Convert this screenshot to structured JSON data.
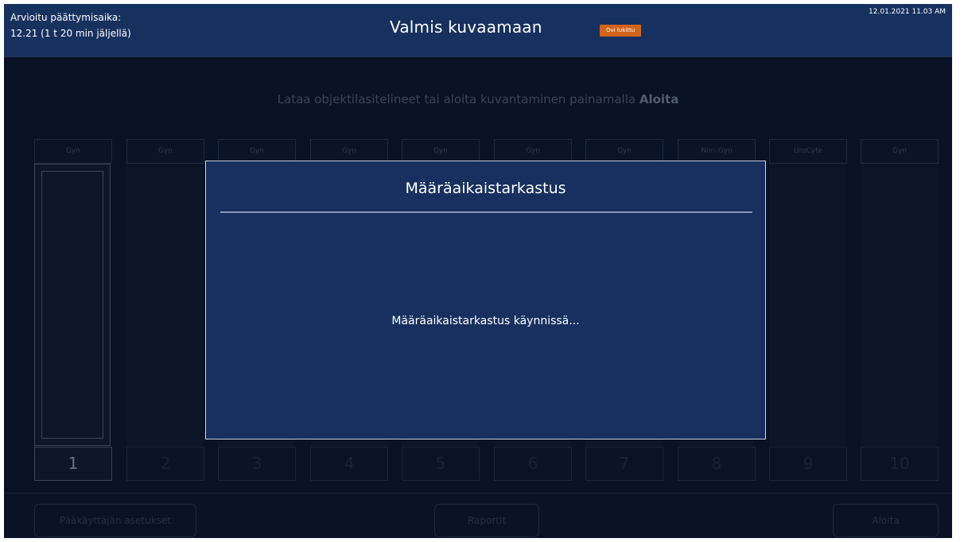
{
  "header": {
    "estimated_end_label": "Arvioitu päättymisaika:",
    "estimated_end_value": "12.21 (1 t 20 min jäljellä)",
    "status_title": "Valmis kuvaamaan",
    "door_badge": "Ovi lukittu",
    "datetime": "12.01.2021 11.03 AM",
    "colors": {
      "header_bg": "#17315f",
      "badge": "#d2631c"
    }
  },
  "instruction": {
    "text": "Lataa objektilasitelineet tai aloita kuvantaminen painamalla ",
    "bold": "Aloita"
  },
  "slots": [
    {
      "type": "Gyn",
      "number": "1"
    },
    {
      "type": "Gyn",
      "number": "2"
    },
    {
      "type": "Gyn",
      "number": "3"
    },
    {
      "type": "Gyn",
      "number": "4"
    },
    {
      "type": "Gyn",
      "number": "5"
    },
    {
      "type": "Gyn",
      "number": "6"
    },
    {
      "type": "Gyn",
      "number": "7"
    },
    {
      "type": "Non-Gyn",
      "number": "8"
    },
    {
      "type": "UroCyte",
      "number": "9"
    },
    {
      "type": "Gyn",
      "number": "10"
    }
  ],
  "buttons": {
    "admin_settings": "Pääkäyttäjän asetukset",
    "reports": "Raportit",
    "start": "Aloita"
  },
  "modal": {
    "title": "Määräaikaistarkastus",
    "message": "Määräaikaistarkastus käynnissä..."
  }
}
